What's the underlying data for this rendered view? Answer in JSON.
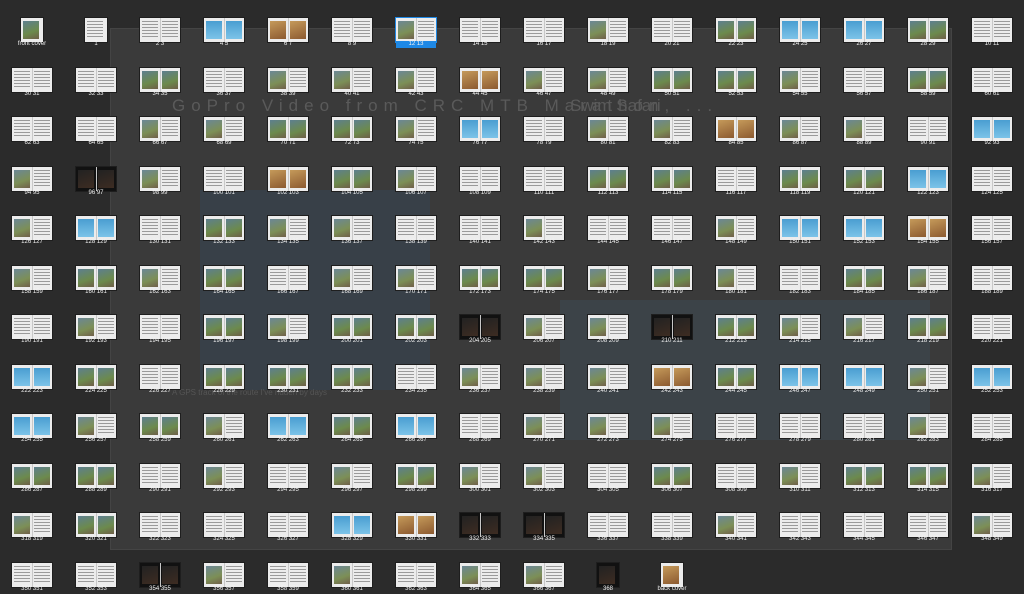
{
  "background_page": {
    "left_title": "GoPro Video from CRC MTB Marathon, ...",
    "right_title": "Swim Safari",
    "caption": "A GPS track of the route I've ridden by days"
  },
  "selected_index": 6,
  "spreads": [
    {
      "label": "front cover",
      "kind": "single",
      "style": "photo"
    },
    {
      "label": "1",
      "kind": "single",
      "style": "text"
    },
    {
      "label": "2   3",
      "style": "text"
    },
    {
      "label": "4   5",
      "style": "blue"
    },
    {
      "label": "6   7",
      "style": "warm"
    },
    {
      "label": "8   9",
      "style": "text"
    },
    {
      "label": "12  13",
      "style": "mixed"
    },
    {
      "label": "14  15",
      "style": "text"
    },
    {
      "label": "16  17",
      "style": "text"
    },
    {
      "label": "18  19",
      "style": "mixed"
    },
    {
      "label": "20  21",
      "style": "text"
    },
    {
      "label": "22  23",
      "style": "photo"
    },
    {
      "label": "24  25",
      "style": "blue"
    },
    {
      "label": "26  27",
      "style": "blue"
    },
    {
      "label": "28  29",
      "style": "photo"
    },
    {
      "label": "10  11",
      "style": "text"
    },
    {
      "label": "30  31",
      "style": "text"
    },
    {
      "label": "32  33",
      "style": "text"
    },
    {
      "label": "34  35",
      "style": "photo"
    },
    {
      "label": "36  37",
      "style": "text"
    },
    {
      "label": "38  39",
      "style": "mixed"
    },
    {
      "label": "40  41",
      "style": "mixed"
    },
    {
      "label": "42  43",
      "style": "mixed"
    },
    {
      "label": "44  45",
      "style": "warm"
    },
    {
      "label": "46  47",
      "style": "mixed"
    },
    {
      "label": "48  49",
      "style": "mixed"
    },
    {
      "label": "50  51",
      "style": "photo"
    },
    {
      "label": "52  53",
      "style": "photo"
    },
    {
      "label": "54  55",
      "style": "mixed"
    },
    {
      "label": "56  57",
      "style": "text"
    },
    {
      "label": "58  59",
      "style": "photo"
    },
    {
      "label": "60  61",
      "style": "text"
    },
    {
      "label": "62  63",
      "style": "text"
    },
    {
      "label": "64  65",
      "style": "text"
    },
    {
      "label": "66  67",
      "style": "mixed"
    },
    {
      "label": "68  69",
      "style": "mixed"
    },
    {
      "label": "70  71",
      "style": "photo"
    },
    {
      "label": "72  73",
      "style": "photo"
    },
    {
      "label": "74  75",
      "style": "mixed"
    },
    {
      "label": "76  77",
      "style": "blue"
    },
    {
      "label": "78  79",
      "style": "text"
    },
    {
      "label": "80  81",
      "style": "mixed"
    },
    {
      "label": "82  83",
      "style": "mixed"
    },
    {
      "label": "84  85",
      "style": "warm"
    },
    {
      "label": "86  87",
      "style": "mixed"
    },
    {
      "label": "88  89",
      "style": "mixed"
    },
    {
      "label": "90  91",
      "style": "text"
    },
    {
      "label": "92  93",
      "style": "blue"
    },
    {
      "label": "94  95",
      "style": "mixed"
    },
    {
      "label": "96  97",
      "style": "dark"
    },
    {
      "label": "98  99",
      "style": "mixed"
    },
    {
      "label": "100  101",
      "style": "text"
    },
    {
      "label": "102  103",
      "style": "warm"
    },
    {
      "label": "104  105",
      "style": "photo"
    },
    {
      "label": "106  107",
      "style": "mixed"
    },
    {
      "label": "108  109",
      "style": "text"
    },
    {
      "label": "110  111",
      "style": "text"
    },
    {
      "label": "112  113",
      "style": "photo"
    },
    {
      "label": "114  115",
      "style": "photo"
    },
    {
      "label": "116  117",
      "style": "text"
    },
    {
      "label": "118  119",
      "style": "photo"
    },
    {
      "label": "120  121",
      "style": "photo"
    },
    {
      "label": "122  123",
      "style": "blue"
    },
    {
      "label": "124  125",
      "style": "text"
    },
    {
      "label": "126  127",
      "style": "mixed"
    },
    {
      "label": "128  129",
      "style": "blue"
    },
    {
      "label": "130  131",
      "style": "text"
    },
    {
      "label": "132  133",
      "style": "photo"
    },
    {
      "label": "134  135",
      "style": "mixed"
    },
    {
      "label": "136  137",
      "style": "mixed"
    },
    {
      "label": "138  139",
      "style": "text"
    },
    {
      "label": "140  141",
      "style": "text"
    },
    {
      "label": "142  143",
      "style": "mixed"
    },
    {
      "label": "144  145",
      "style": "text"
    },
    {
      "label": "146  147",
      "style": "text"
    },
    {
      "label": "148  149",
      "style": "mixed"
    },
    {
      "label": "150  151",
      "style": "blue"
    },
    {
      "label": "152  153",
      "style": "blue"
    },
    {
      "label": "154  155",
      "style": "warm"
    },
    {
      "label": "156  157",
      "style": "text"
    },
    {
      "label": "158  159",
      "style": "mixed"
    },
    {
      "label": "160  161",
      "style": "photo"
    },
    {
      "label": "162  163",
      "style": "mixed"
    },
    {
      "label": "164  165",
      "style": "photo"
    },
    {
      "label": "166  167",
      "style": "text"
    },
    {
      "label": "168  169",
      "style": "mixed"
    },
    {
      "label": "170  171",
      "style": "mixed"
    },
    {
      "label": "172  173",
      "style": "photo"
    },
    {
      "label": "174  175",
      "style": "photo"
    },
    {
      "label": "176  177",
      "style": "mixed"
    },
    {
      "label": "178  179",
      "style": "photo"
    },
    {
      "label": "180  181",
      "style": "mixed"
    },
    {
      "label": "182  183",
      "style": "text"
    },
    {
      "label": "184  185",
      "style": "photo"
    },
    {
      "label": "186  187",
      "style": "mixed"
    },
    {
      "label": "188  189",
      "style": "text"
    },
    {
      "label": "190  191",
      "style": "text"
    },
    {
      "label": "192  193",
      "style": "mixed"
    },
    {
      "label": "194  195",
      "style": "text"
    },
    {
      "label": "196  197",
      "style": "photo"
    },
    {
      "label": "198  199",
      "style": "mixed"
    },
    {
      "label": "200  201",
      "style": "photo"
    },
    {
      "label": "202  203",
      "style": "photo"
    },
    {
      "label": "204  205",
      "style": "dark"
    },
    {
      "label": "206  207",
      "style": "mixed"
    },
    {
      "label": "208  209",
      "style": "mixed"
    },
    {
      "label": "210  211",
      "style": "dark"
    },
    {
      "label": "212  213",
      "style": "photo"
    },
    {
      "label": "214  215",
      "style": "mixed"
    },
    {
      "label": "216  217",
      "style": "mixed"
    },
    {
      "label": "218  219",
      "style": "photo"
    },
    {
      "label": "220  221",
      "style": "text"
    },
    {
      "label": "222  223",
      "style": "blue"
    },
    {
      "label": "224  225",
      "style": "photo"
    },
    {
      "label": "226  227",
      "style": "text"
    },
    {
      "label": "228  229",
      "style": "photo"
    },
    {
      "label": "230  231",
      "style": "photo"
    },
    {
      "label": "232  233",
      "style": "photo"
    },
    {
      "label": "234  235",
      "style": "text"
    },
    {
      "label": "236  237",
      "style": "mixed"
    },
    {
      "label": "238  239",
      "style": "mixed"
    },
    {
      "label": "240  241",
      "style": "mixed"
    },
    {
      "label": "242  243",
      "style": "warm"
    },
    {
      "label": "244  245",
      "style": "photo"
    },
    {
      "label": "246  247",
      "style": "blue"
    },
    {
      "label": "248  249",
      "style": "blue"
    },
    {
      "label": "250  251",
      "style": "mixed"
    },
    {
      "label": "252  253",
      "style": "blue"
    },
    {
      "label": "254  255",
      "style": "blue"
    },
    {
      "label": "256  257",
      "style": "mixed"
    },
    {
      "label": "258  259",
      "style": "photo"
    },
    {
      "label": "260  261",
      "style": "mixed"
    },
    {
      "label": "262  263",
      "style": "blue"
    },
    {
      "label": "264  265",
      "style": "photo"
    },
    {
      "label": "266  267",
      "style": "blue"
    },
    {
      "label": "268  269",
      "style": "text"
    },
    {
      "label": "270  271",
      "style": "mixed"
    },
    {
      "label": "272  273",
      "style": "mixed"
    },
    {
      "label": "274  275",
      "style": "mixed"
    },
    {
      "label": "276  277",
      "style": "text"
    },
    {
      "label": "278  279",
      "style": "text"
    },
    {
      "label": "280  281",
      "style": "text"
    },
    {
      "label": "282  283",
      "style": "mixed"
    },
    {
      "label": "284  285",
      "style": "text"
    },
    {
      "label": "286  287",
      "style": "photo"
    },
    {
      "label": "288  289",
      "style": "photo"
    },
    {
      "label": "290  291",
      "style": "text"
    },
    {
      "label": "292  293",
      "style": "mixed"
    },
    {
      "label": "294  295",
      "style": "text"
    },
    {
      "label": "296  297",
      "style": "mixed"
    },
    {
      "label": "298  299",
      "style": "photo"
    },
    {
      "label": "300  301",
      "style": "mixed"
    },
    {
      "label": "302  303",
      "style": "mixed"
    },
    {
      "label": "304  305",
      "style": "text"
    },
    {
      "label": "306  307",
      "style": "photo"
    },
    {
      "label": "308  309",
      "style": "text"
    },
    {
      "label": "310  311",
      "style": "mixed"
    },
    {
      "label": "312  313",
      "style": "photo"
    },
    {
      "label": "314  315",
      "style": "photo"
    },
    {
      "label": "316  317",
      "style": "mixed"
    },
    {
      "label": "318  319",
      "style": "mixed"
    },
    {
      "label": "320  321",
      "style": "photo"
    },
    {
      "label": "322  323",
      "style": "text"
    },
    {
      "label": "324  325",
      "style": "text"
    },
    {
      "label": "326  327",
      "style": "text"
    },
    {
      "label": "328  329",
      "style": "blue"
    },
    {
      "label": "330  331",
      "style": "warm"
    },
    {
      "label": "332  333",
      "style": "dark"
    },
    {
      "label": "334  335",
      "style": "dark"
    },
    {
      "label": "336  337",
      "style": "text"
    },
    {
      "label": "338  339",
      "style": "text"
    },
    {
      "label": "340  341",
      "style": "mixed"
    },
    {
      "label": "342  343",
      "style": "text"
    },
    {
      "label": "344  345",
      "style": "text"
    },
    {
      "label": "346  347",
      "style": "text"
    },
    {
      "label": "348  349",
      "style": "mixed"
    },
    {
      "label": "350  351",
      "style": "text"
    },
    {
      "label": "352  353",
      "style": "text"
    },
    {
      "label": "354  355",
      "style": "dark"
    },
    {
      "label": "356  357",
      "style": "mixed"
    },
    {
      "label": "358  359",
      "style": "text"
    },
    {
      "label": "360  361",
      "style": "mixed"
    },
    {
      "label": "362  363",
      "style": "text"
    },
    {
      "label": "364  365",
      "style": "mixed"
    },
    {
      "label": "366  367",
      "style": "mixed"
    },
    {
      "label": "368",
      "kind": "single",
      "style": "dark"
    },
    {
      "label": "back cover",
      "kind": "single",
      "style": "warm"
    }
  ]
}
